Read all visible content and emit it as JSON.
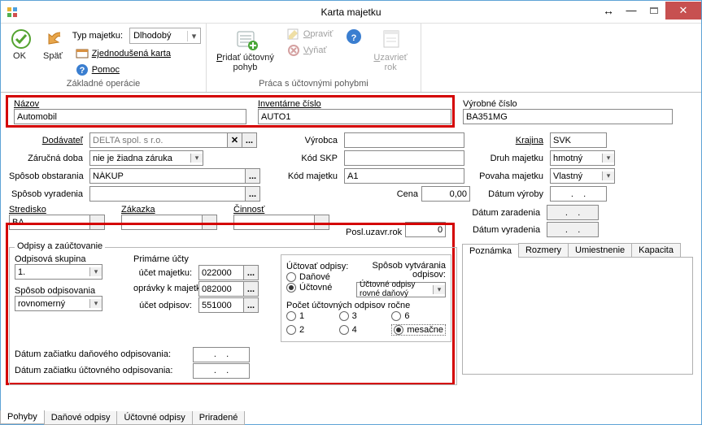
{
  "window": {
    "title": "Karta majetku"
  },
  "ribbon": {
    "ok": "OK",
    "spat": "Späť",
    "typ_majetku_label": "Typ majetku:",
    "typ_majetku_value": "Dlhodobý",
    "zjednodusena": "Zjednodušená karta",
    "pomoc": "Pomoc",
    "group1_label": "Základné operácie",
    "pridat": "Pridať účtovný pohyb",
    "opravit": "Opraviť",
    "vynat": "Vyňať",
    "uzavriet": "Uzavrieť rok",
    "group2_label": "Práca s účtovnými pohybmi"
  },
  "fields": {
    "nazov_label": "Názov",
    "nazov_value": "Automobil",
    "inventarne_label": "Inventárne číslo",
    "inventarne_value": "AUTO1",
    "vyrobne_label": "Výrobné číslo",
    "vyrobne_value": "BA351MG",
    "dodavatel_label": "Dodávateľ",
    "dodavatel_value": "DELTA spol. s r.o.",
    "vyrobca_label": "Výrobca",
    "vyrobca_value": "",
    "krajina_label": "Krajina",
    "krajina_value": "SVK",
    "zarucna_label": "Záručná doba",
    "zarucna_value": "nie je žiadna záruka",
    "kodskp_label": "Kód SKP",
    "kodskp_value": "",
    "druh_label": "Druh majetku",
    "druh_value": "hmotný",
    "sposob_obst_label": "Spôsob obstarania",
    "sposob_obst_value": "NÁKUP",
    "kodmajetku_label": "Kód majetku",
    "kodmajetku_value": "A1",
    "povaha_label": "Povaha majetku",
    "povaha_value": "Vlastný",
    "sposob_vyrad_label": "Spôsob vyradenia",
    "sposob_vyrad_value": "",
    "cena_label": "Cena",
    "cena_value": "0,00",
    "datum_vyroby_label": "Dátum výroby",
    "datum_vyroby_value": ".    .",
    "stredisko_label": "Stredisko",
    "stredisko_value": "BA",
    "zakazka_label": "Zákazka",
    "zakazka_value": "",
    "cinnost_label": "Činnosť",
    "cinnost_value": "",
    "posl_label": "Posl.uzavr.rok",
    "posl_value": "0",
    "datum_zarad_label": "Dátum zaradenia",
    "datum_zarad_value": ".    .",
    "datum_vyrad_label": "Dátum vyradenia",
    "datum_vyrad_value": ".    ."
  },
  "odpisy": {
    "group_title": "Odpisy a zaúčtovanie",
    "skupina_label": "Odpisová skupina",
    "skupina_value": "1.",
    "sposob_odp_label": "Spôsob odpisovania",
    "sposob_odp_value": "rovnomerný",
    "primarne_label": "Primárne účty",
    "ucet_majetku_label": "účet majetku:",
    "ucet_majetku_value": "022000",
    "opravky_label": "oprávky k majetku:",
    "opravky_value": "082000",
    "ucet_odpisov_label": "účet odpisov:",
    "ucet_odpisov_value": "551000",
    "datum_dan_label": "Dátum začiatku daňového odpisovania:",
    "datum_dan_value": ".    .",
    "datum_uct_label": "Dátum začiatku účtovného odpisovania:",
    "datum_uct_value": ".    .",
    "uctovat_label": "Účtovať odpisy:",
    "danove": "Daňové",
    "uctovne": "Účtovné",
    "sposob_vytv_label": "Spôsob vytvárania odpisov:",
    "sposob_vytv_value": "Účtovné odpisy rovné daňový",
    "pocet_label": "Počet účtovných odpisov ročne",
    "r1": "1",
    "r2": "2",
    "r3": "3",
    "r4": "4",
    "r6": "6",
    "rmesacne": "mesačne"
  },
  "tabs_right": {
    "poznamka": "Poznámka",
    "rozmery": "Rozmery",
    "umiestnenie": "Umiestnenie",
    "kapacita": "Kapacita"
  },
  "tabs_bottom": {
    "pohyby": "Pohyby",
    "danove": "Daňové odpisy",
    "uctovne": "Účtovné odpisy",
    "priradene": "Priradené"
  }
}
